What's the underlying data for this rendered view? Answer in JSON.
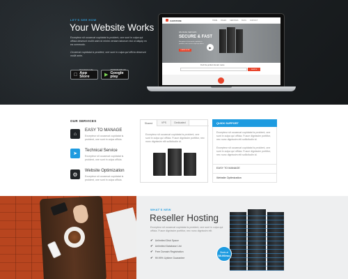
{
  "hero": {
    "kicker": "LET'S SEE HOW",
    "title": "Your Website Works",
    "para1": "Excepteur sit occaecat cupidatat is proident, one sunt in culpa qui officia deserunt mollit anim id minim veniam laborum nisi ut aliquip ex ea commodo.",
    "para2": "Occaecat cupidatat is proident, one sunt in culpa qui officia deserunt mollit anim.",
    "app_store_small": "Download on the",
    "app_store": "App Store",
    "google_play_small": "ANDROID APP ON",
    "google_play": "Google play",
    "screen": {
      "logo": "CARSTORE",
      "nav": [
        "HOME",
        "PAGES",
        "SERVICES",
        "BLOG",
        "CONTACT"
      ],
      "kicker": "WE MAKE SERVERS",
      "title": "SECURE & FAST",
      "text": "Excepteur sit occaecat cupidatat is proident, one sunt in culpa qui officia.",
      "button": "LEARN MORE",
      "domain_label": "Find the perfect domain name",
      "search_button": "SEARCH"
    }
  },
  "services": {
    "heading": "OUR SERVICES",
    "items": [
      {
        "title": "EASY TO MANAGE",
        "text": "Excepteur sit occaecat cupidatat is proident, one sunt in culpa officia.",
        "icon": "home-icon"
      },
      {
        "title": "Technical Service",
        "text": "Excepteur sit occaecat cupidatat is proident, one sunt in culpa officia.",
        "icon": "paper-plane-icon"
      },
      {
        "title": "Website Optimization",
        "text": "Excepteur sit occaecat cupidatat is proident, one sunt in culpa officia.",
        "icon": "gear-icon"
      }
    ]
  },
  "tabs": {
    "labels": [
      "Shared",
      "VPS",
      "Dedicated"
    ],
    "text": "Excepteur sit occaecat cupidatat is proident, one sunt in culpa qui officia. Fusce dignissim porttitor, nec nunc dignissim elit sollicitudin id."
  },
  "quick_support": {
    "title": "QUICK SUPPORT",
    "para1": "Excepteur sit occaecat cupidatat is proident, one sunt in culpa qui officia. Fusce dignissim porttitor, nec nunc dignissim elit sollicitudin id.",
    "para2": "Excepteur sit occaecat cupidatat is proident, one sunt in culpa qui officia. Fusce dignissim porttitor, nec nunc dignissim elit sollicitudin id.",
    "link1": "EASY TO MANAGE",
    "link2": "Website Optimization"
  },
  "promo": {
    "kicker": "WHAT'S NEW",
    "title": "Reseller Hosting",
    "text": "Excepteur sit occaecat cupidatat is proident, one sunt in culpa qui officia. Fusce dignissim porttitor, nec nunc dignissim elit.",
    "features": [
      "Unlimited Disk Space",
      "Unlimited Database List",
      "Free Domain Registration",
      "99.99% Uptime Guarantee"
    ],
    "badge_line1": "Starts at",
    "badge_line2": "$9.99/mo"
  },
  "colors": {
    "accent": "#1e9be0",
    "dark": "#1b1f22"
  }
}
